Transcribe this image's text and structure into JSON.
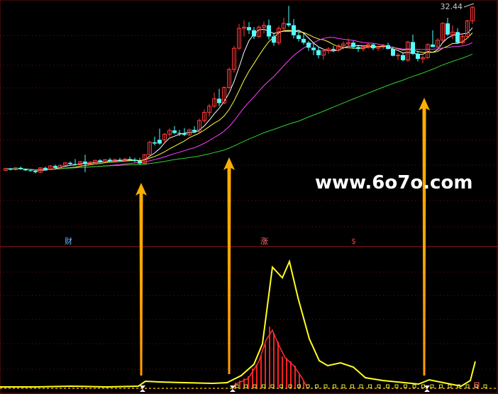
{
  "chart_data": {
    "type": "candlestick",
    "price_label": "32.44",
    "watermark": "www.6o7o.com",
    "markers": [
      "财",
      "涨",
      "$"
    ],
    "price_range": [
      5.0,
      33.0
    ],
    "candles": [
      [
        6.1,
        6.5,
        6.0,
        6.4,
        "up"
      ],
      [
        6.4,
        6.5,
        6.1,
        6.2,
        "down"
      ],
      [
        6.2,
        6.6,
        6.1,
        6.5,
        "up"
      ],
      [
        6.5,
        6.7,
        6.2,
        6.3,
        "down"
      ],
      [
        6.3,
        6.4,
        6.0,
        6.1,
        "down"
      ],
      [
        6.1,
        6.3,
        5.9,
        6.0,
        "down"
      ],
      [
        6.0,
        6.1,
        5.6,
        5.8,
        "down"
      ],
      [
        5.8,
        6.6,
        5.7,
        6.5,
        "up"
      ],
      [
        6.5,
        6.7,
        6.1,
        6.2,
        "down"
      ],
      [
        6.2,
        6.9,
        6.1,
        6.8,
        "up"
      ],
      [
        6.8,
        7.0,
        6.4,
        6.5,
        "down"
      ],
      [
        6.5,
        7.0,
        6.4,
        6.9,
        "up"
      ],
      [
        6.9,
        7.4,
        6.8,
        7.3,
        "up"
      ],
      [
        7.3,
        7.5,
        7.0,
        7.1,
        "down"
      ],
      [
        7.1,
        7.9,
        6.9,
        7.0,
        "down"
      ],
      [
        7.0,
        7.6,
        6.9,
        7.5,
        "up"
      ],
      [
        7.5,
        8.6,
        5.8,
        7.1,
        "down"
      ],
      [
        7.1,
        7.6,
        6.9,
        7.4,
        "up"
      ],
      [
        7.4,
        7.8,
        7.1,
        7.7,
        "up"
      ],
      [
        7.7,
        7.9,
        7.3,
        7.5,
        "down"
      ],
      [
        7.5,
        7.9,
        7.4,
        7.8,
        "up"
      ],
      [
        7.8,
        8.1,
        7.5,
        7.6,
        "down"
      ],
      [
        7.6,
        8.0,
        7.4,
        7.8,
        "up"
      ],
      [
        7.8,
        8.1,
        7.5,
        7.7,
        "down"
      ],
      [
        7.7,
        8.1,
        7.5,
        7.9,
        "up"
      ],
      [
        7.9,
        8.3,
        7.6,
        7.8,
        "down"
      ],
      [
        7.8,
        8.1,
        7.4,
        7.6,
        "down"
      ],
      [
        7.6,
        8.1,
        7.0,
        7.2,
        "down"
      ],
      [
        7.2,
        8.7,
        7.1,
        8.6,
        "up"
      ],
      [
        8.6,
        10.8,
        8.5,
        10.6,
        "up"
      ],
      [
        10.6,
        11.5,
        10.1,
        10.4,
        "down"
      ],
      [
        10.4,
        12.8,
        10.2,
        11.0,
        "down"
      ],
      [
        11.0,
        12.1,
        10.5,
        11.9,
        "up"
      ],
      [
        11.9,
        12.8,
        11.5,
        12.5,
        "up"
      ],
      [
        12.5,
        13.2,
        11.9,
        12.1,
        "down"
      ],
      [
        12.1,
        12.6,
        11.6,
        12.0,
        "down"
      ],
      [
        12.0,
        12.9,
        11.6,
        11.8,
        "down"
      ],
      [
        11.8,
        12.8,
        11.6,
        12.6,
        "up"
      ],
      [
        12.6,
        13.2,
        12.1,
        12.3,
        "down"
      ],
      [
        12.3,
        14.4,
        12.1,
        14.1,
        "up"
      ],
      [
        14.1,
        15.9,
        13.7,
        15.4,
        "up"
      ],
      [
        15.4,
        16.8,
        14.7,
        16.4,
        "up"
      ],
      [
        16.4,
        18.6,
        16.1,
        17.6,
        "up"
      ],
      [
        17.6,
        19.2,
        16.4,
        16.9,
        "down"
      ],
      [
        16.9,
        19.6,
        16.7,
        19.4,
        "up"
      ],
      [
        19.4,
        22.6,
        19.1,
        22.3,
        "up"
      ],
      [
        22.3,
        26.1,
        21.8,
        25.7,
        "up"
      ],
      [
        25.7,
        29.6,
        25.4,
        28.9,
        "up"
      ],
      [
        28.9,
        30.2,
        27.6,
        29.1,
        "up"
      ],
      [
        29.1,
        29.9,
        28.0,
        28.6,
        "down"
      ],
      [
        28.6,
        29.1,
        27.2,
        27.6,
        "down"
      ],
      [
        27.6,
        29.4,
        27.3,
        29.1,
        "up"
      ],
      [
        29.1,
        30.0,
        28.1,
        29.4,
        "up"
      ],
      [
        29.4,
        30.3,
        27.1,
        27.6,
        "down"
      ],
      [
        27.6,
        28.2,
        26.1,
        26.6,
        "down"
      ],
      [
        26.6,
        29.3,
        26.2,
        28.9,
        "up"
      ],
      [
        28.9,
        30.6,
        28.4,
        29.7,
        "up"
      ],
      [
        29.7,
        32.5,
        29.1,
        29.4,
        "down"
      ],
      [
        29.4,
        30.4,
        27.3,
        27.8,
        "down"
      ],
      [
        27.8,
        28.6,
        26.8,
        27.2,
        "down"
      ],
      [
        27.2,
        28.1,
        26.3,
        26.6,
        "down"
      ],
      [
        26.6,
        26.9,
        25.3,
        25.8,
        "down"
      ],
      [
        25.8,
        26.6,
        24.6,
        25.4,
        "down"
      ],
      [
        25.4,
        26.0,
        24.1,
        24.6,
        "down"
      ],
      [
        24.6,
        25.6,
        23.9,
        25.3,
        "up"
      ],
      [
        25.3,
        25.9,
        24.8,
        25.6,
        "up"
      ],
      [
        25.6,
        26.1,
        25.1,
        25.4,
        "down"
      ],
      [
        25.4,
        26.4,
        25.1,
        26.1,
        "up"
      ],
      [
        26.1,
        26.8,
        25.5,
        26.4,
        "up"
      ],
      [
        26.4,
        27.3,
        25.9,
        26.6,
        "up"
      ],
      [
        26.6,
        26.9,
        25.6,
        25.9,
        "down"
      ],
      [
        25.9,
        26.3,
        25.1,
        25.6,
        "down"
      ],
      [
        25.6,
        26.2,
        25.2,
        26.0,
        "up"
      ],
      [
        26.0,
        26.6,
        25.6,
        26.3,
        "up"
      ],
      [
        26.3,
        26.5,
        25.4,
        25.7,
        "down"
      ],
      [
        25.7,
        26.1,
        25.3,
        25.9,
        "up"
      ],
      [
        25.9,
        26.4,
        25.5,
        26.2,
        "up"
      ],
      [
        26.2,
        26.6,
        25.5,
        25.6,
        "down"
      ],
      [
        25.6,
        26.0,
        24.4,
        24.5,
        "down"
      ],
      [
        24.5,
        24.9,
        23.8,
        24.6,
        "up"
      ],
      [
        24.6,
        24.9,
        23.6,
        23.8,
        "down"
      ],
      [
        23.8,
        26.9,
        23.5,
        26.7,
        "up"
      ],
      [
        26.7,
        27.9,
        24.6,
        24.8,
        "down"
      ],
      [
        24.8,
        25.3,
        23.6,
        24.0,
        "down"
      ],
      [
        24.0,
        24.5,
        23.3,
        24.2,
        "up"
      ],
      [
        24.2,
        26.5,
        24.0,
        26.3,
        "up"
      ],
      [
        26.3,
        28.6,
        25.9,
        25.9,
        "down"
      ],
      [
        25.9,
        27.3,
        25.7,
        27.0,
        "up"
      ],
      [
        27.0,
        29.9,
        26.7,
        29.7,
        "up"
      ],
      [
        29.7,
        30.6,
        27.7,
        27.9,
        "down"
      ],
      [
        27.9,
        29.4,
        27.2,
        28.3,
        "up"
      ],
      [
        28.3,
        28.9,
        26.4,
        26.6,
        "down"
      ],
      [
        26.6,
        28.1,
        26.3,
        27.6,
        "up"
      ],
      [
        27.6,
        30.3,
        27.3,
        30.1,
        "up"
      ],
      [
        30.1,
        32.44,
        29.6,
        32.3,
        "up"
      ]
    ]
  }
}
